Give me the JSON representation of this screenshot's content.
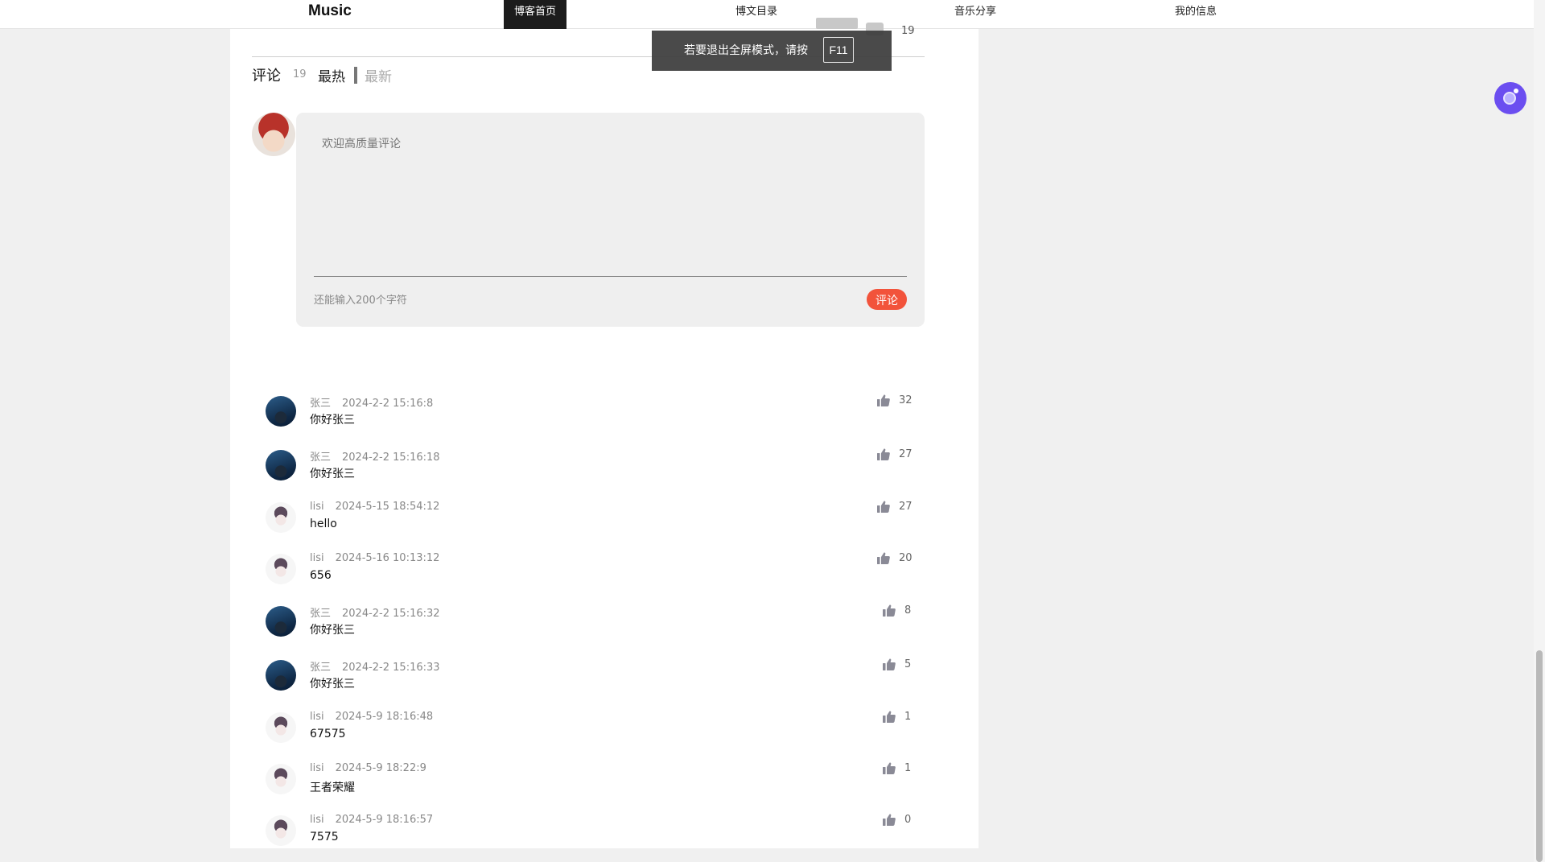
{
  "nav": {
    "brand": "Music",
    "items": [
      {
        "label": "博客首页",
        "active": true
      },
      {
        "label": "博文目录",
        "active": false
      },
      {
        "label": "音乐分享",
        "active": false
      },
      {
        "label": "我的信息",
        "active": false
      }
    ]
  },
  "post_stats": {
    "count": "19"
  },
  "toast": {
    "text": "若要退出全屏模式，请按",
    "key": "F11"
  },
  "comments_header": {
    "title": "评论",
    "count": "19",
    "sort_hot": "最热",
    "sort_new": "最新"
  },
  "composer": {
    "placeholder": "欢迎高质量评论",
    "remaining": "还能输入200个字符",
    "submit_label": "评论"
  },
  "comments": [
    {
      "user": "张三",
      "time": "2024-2-2 15:16:8",
      "text": "你好张三",
      "likes": "32",
      "avatar": "dark"
    },
    {
      "user": "张三",
      "time": "2024-2-2 15:16:18",
      "text": "你好张三",
      "likes": "27",
      "avatar": "dark"
    },
    {
      "user": "lisi",
      "time": "2024-5-15 18:54:12",
      "text": "hello",
      "likes": "27",
      "avatar": "anime"
    },
    {
      "user": "lisi",
      "time": "2024-5-16 10:13:12",
      "text": "656",
      "likes": "20",
      "avatar": "anime"
    },
    {
      "user": "张三",
      "time": "2024-2-2 15:16:32",
      "text": "你好张三",
      "likes": "8",
      "avatar": "dark"
    },
    {
      "user": "张三",
      "time": "2024-2-2 15:16:33",
      "text": "你好张三",
      "likes": "5",
      "avatar": "dark"
    },
    {
      "user": "lisi",
      "time": "2024-5-9 18:16:48",
      "text": "67575",
      "likes": "1",
      "avatar": "anime"
    },
    {
      "user": "lisi",
      "time": "2024-5-9 18:22:9",
      "text": "王者荣耀",
      "likes": "1",
      "avatar": "anime"
    },
    {
      "user": "lisi",
      "time": "2024-5-9 18:16:57",
      "text": "7575",
      "likes": "0",
      "avatar": "anime"
    }
  ],
  "colors": {
    "submit_button": "#f2533b",
    "assistant": "#6b4ef0",
    "active_nav": "#1c1c1c"
  },
  "icons": {
    "like": "thumbs-up-icon",
    "assistant": "assistant-icon"
  }
}
